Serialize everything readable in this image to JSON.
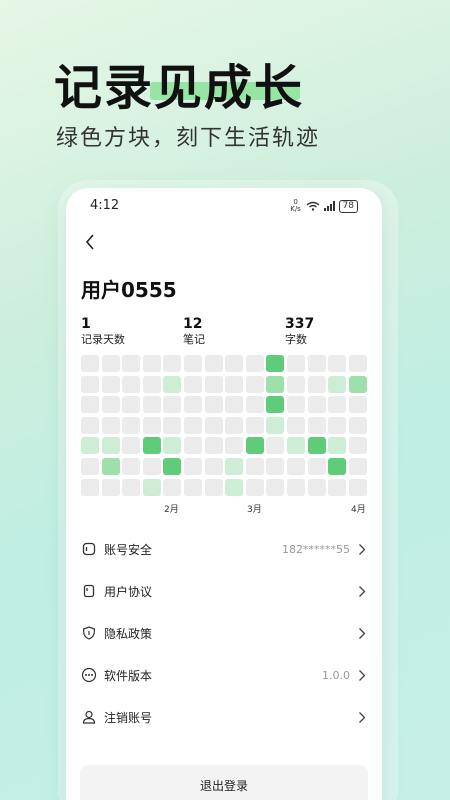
{
  "hero": {
    "title": "记录见成长",
    "subtitle": "绿色方块，刻下生活轨迹"
  },
  "status_bar": {
    "time": "4:12",
    "speed": "0 K/s",
    "battery": "78"
  },
  "profile": {
    "username": "用户0555",
    "stats": [
      {
        "value": "1",
        "label": "记录天数"
      },
      {
        "value": "12",
        "label": "笔记"
      },
      {
        "value": "337",
        "label": "字数"
      }
    ]
  },
  "heatmap": {
    "months": [
      "2月",
      "3月",
      "4月"
    ],
    "colors": {
      "empty": "#ebebeb",
      "light": "#cdeed4",
      "medium": "#9ee0ab",
      "dark": "#5fcc79"
    },
    "grid": [
      [
        0,
        0,
        0,
        0,
        0,
        0,
        0,
        0,
        0,
        3,
        0,
        0,
        0,
        0
      ],
      [
        0,
        0,
        0,
        0,
        1,
        0,
        0,
        0,
        0,
        2,
        0,
        0,
        1,
        2
      ],
      [
        0,
        0,
        0,
        0,
        0,
        0,
        0,
        0,
        0,
        3,
        0,
        0,
        0,
        0
      ],
      [
        0,
        0,
        0,
        0,
        0,
        0,
        0,
        0,
        0,
        1,
        0,
        0,
        0,
        0
      ],
      [
        1,
        1,
        0,
        3,
        1,
        0,
        0,
        0,
        3,
        0,
        1,
        3,
        1,
        0
      ],
      [
        0,
        2,
        0,
        0,
        3,
        0,
        0,
        1,
        0,
        0,
        0,
        0,
        3,
        0
      ],
      [
        0,
        0,
        0,
        1,
        0,
        0,
        0,
        1,
        0,
        0,
        0,
        0,
        0,
        0
      ]
    ]
  },
  "menu": [
    {
      "label": "账号安全",
      "value": "182******55",
      "icon": "shield-lock-icon"
    },
    {
      "label": "用户协议",
      "value": "",
      "icon": "document-icon"
    },
    {
      "label": "隐私政策",
      "value": "",
      "icon": "shield-icon"
    },
    {
      "label": "软件版本",
      "value": "1.0.0",
      "icon": "more-circle-icon"
    },
    {
      "label": "注销账号",
      "value": "",
      "icon": "user-icon"
    }
  ],
  "logout_label": "退出登录"
}
